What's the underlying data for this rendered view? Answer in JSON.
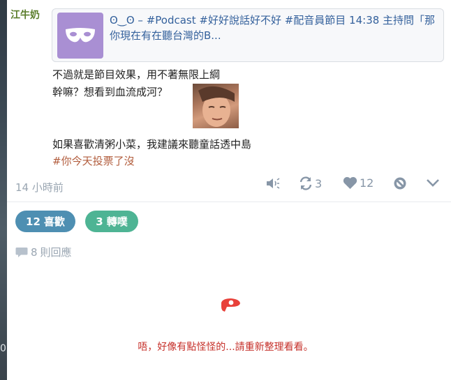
{
  "post": {
    "author": "江牛奶",
    "card": {
      "icon": "mask-icon",
      "icon_bg": "#a98fd3",
      "title": "ʘ‿ʘ – #Podcast #好好說話好不好 #配音員節目 14:38 主持問「那你現在有在聽台灣的B..."
    },
    "lines": [
      "不過就是節目效果，用不著無限上綱",
      "幹嘛？想看到血流成河？",
      "如果喜歡清粥小菜，我建議來聽童話透中島"
    ],
    "hashtag": "#你今天投票了沒",
    "timestamp": "14 小時前",
    "actions": {
      "mute_icon": "speaker-icon",
      "replurk_count": "3",
      "like_count": "12"
    }
  },
  "pills": {
    "like_count": "12",
    "like_label": "喜歡",
    "replurk_count": "3",
    "replurk_label": "轉噗"
  },
  "replies": {
    "count": "8",
    "label": "則回應"
  },
  "error": {
    "message": "唔，好像有點怪怪的...請重新整理看看。"
  },
  "edge": {
    "glyph": "0"
  },
  "colors": {
    "author": "#5a7d2a",
    "link": "#34619c",
    "hashtag": "#b25d3d",
    "like_pill": "#4e8fb2",
    "replurk_pill": "#4eb494",
    "error": "#c6302a"
  }
}
